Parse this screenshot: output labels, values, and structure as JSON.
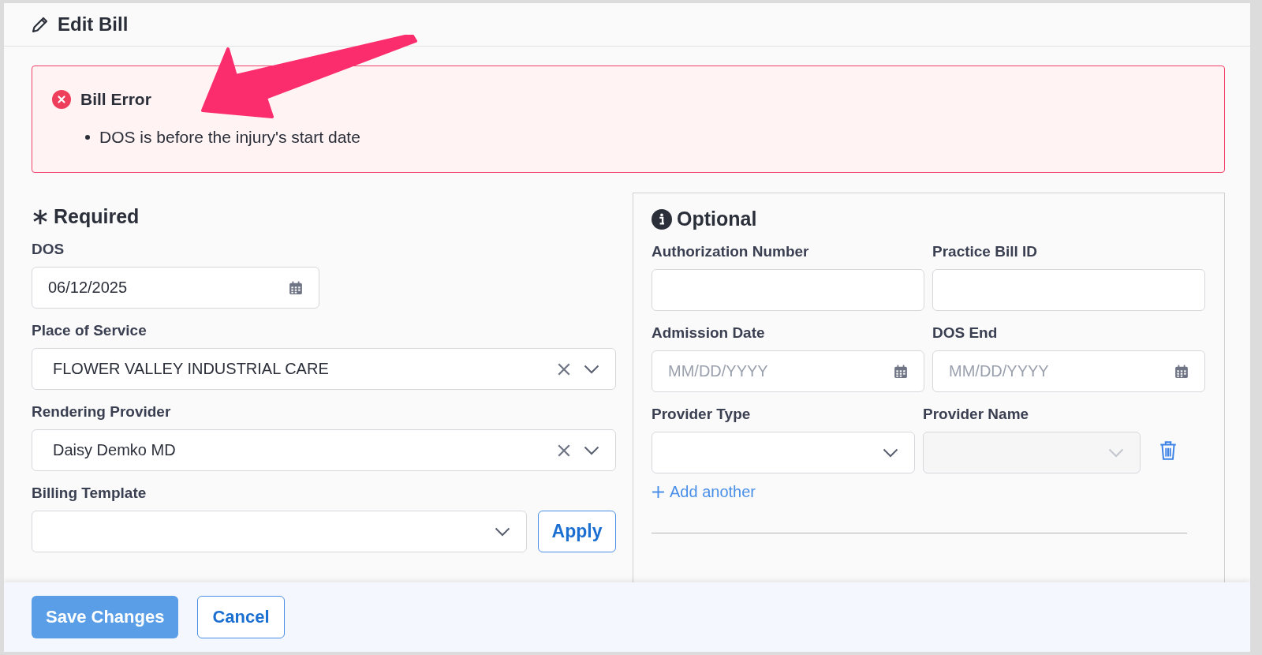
{
  "header": {
    "title": "Edit Bill"
  },
  "error": {
    "title": "Bill Error",
    "messages": [
      "DOS is before the injury's start date"
    ]
  },
  "required": {
    "title": "Required",
    "fields": [
      {
        "kind": "date",
        "label": "DOS",
        "value": "06/12/2025",
        "clearable": false
      },
      {
        "kind": "select",
        "label": "Place of Service",
        "value": "FLOWER VALLEY INDUSTRIAL CARE",
        "clearable": true
      },
      {
        "kind": "select",
        "label": "Rendering Provider",
        "value": "Daisy Demko MD",
        "clearable": true
      },
      {
        "kind": "select",
        "label": "Billing Template",
        "clearable": false,
        "apply": "Apply"
      }
    ]
  },
  "optional": {
    "title": "Optional",
    "fields": [
      {
        "kind": "text",
        "label": "Authorization Number"
      },
      {
        "kind": "text",
        "label": "Practice Bill ID"
      },
      {
        "kind": "date",
        "label": "Admission Date",
        "placeholder": "MM/DD/YYYY"
      },
      {
        "kind": "date",
        "label": "DOS End",
        "placeholder": "MM/DD/YYYY"
      }
    ],
    "provider_rows": [
      {
        "fields": [
          {
            "label": "Provider Type",
            "disabled": false
          },
          {
            "label": "Provider Name",
            "disabled": true
          }
        ],
        "removable": true
      }
    ],
    "add_link": "Add another"
  },
  "annotation": {
    "kind": "arrow"
  },
  "footer": {
    "buttons": [
      {
        "label": "Save Changes",
        "kind": "primary"
      },
      {
        "label": "Cancel",
        "kind": "secondary"
      }
    ]
  }
}
